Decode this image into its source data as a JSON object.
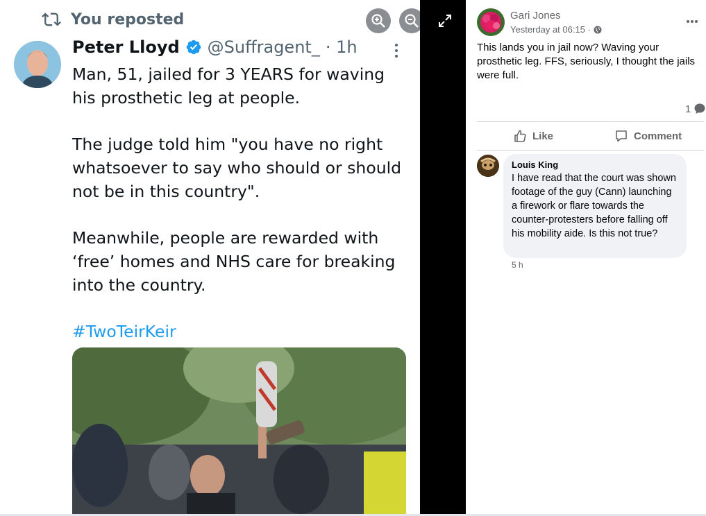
{
  "tweet": {
    "repost_label": "You reposted",
    "author_name": "Peter Lloyd",
    "author_handle": "@Suffragent_",
    "age": "· 1h",
    "paragraphs": [
      "Man, 51, jailed for 3 YEARS for waving his prosthetic leg at people.",
      "The judge told him \"you have no right whatsoever to say who should or should not be in this country\".",
      "Meanwhile, people are rewarded with ‘free’ homes and NHS care for breaking into the country."
    ],
    "hashtag": "#TwoTeirKeir",
    "more_icon": "more-vertical-icon"
  },
  "viewer": {
    "zoom_in_icon": "zoom-in-icon",
    "zoom_out_icon": "zoom-out-icon",
    "expand_icon": "expand-icon"
  },
  "post": {
    "author": "Gari Jones",
    "timestamp": "Yesterday at 06:15 ·",
    "audience_icon": "globe-icon",
    "text": "This lands you in jail now? Waving your prosthetic leg. FFS, seriously, I thought the jails were full.",
    "comment_count": "1",
    "like_label": "Like",
    "comment_label": "Comment"
  },
  "comment": {
    "author": "Louis King",
    "text": "I have read that the court was shown footage of the guy (Cann) launching a firework or flare towards the counter-protesters before falling off his mobility aide. Is this not true?",
    "time": "5 h"
  },
  "colors": {
    "twitter_blue": "#1d9bf0",
    "fb_gray": "#65676b",
    "bubble_bg": "#f0f2f5"
  }
}
